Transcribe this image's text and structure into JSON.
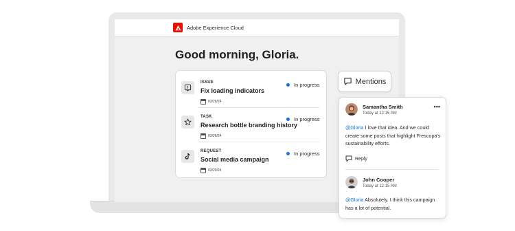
{
  "app": {
    "brand_name": "Adobe Experience Cloud",
    "brand_color": "#eb1000"
  },
  "greeting": "Good morning, Gloria.",
  "work_items": [
    {
      "type": "ISSUE",
      "title": "Fix loading indicators",
      "date": "03/26/24",
      "status": "In progress",
      "icon": "issue-icon"
    },
    {
      "type": "TASK",
      "title": "Research bottle branding history",
      "date": "03/26/24",
      "status": "In progress",
      "icon": "star-icon"
    },
    {
      "type": "REQUEST",
      "title": "Social media campaign",
      "date": "03/29/24",
      "status": "In progress",
      "icon": "tiktok-icon"
    }
  ],
  "status_color": "#1473e6",
  "mentions_button": {
    "label": "Mentions",
    "icon": "comment-icon"
  },
  "comments": [
    {
      "author": "Samantha Smith",
      "time": "Today at 12:15 AM",
      "mention": "@Gloria",
      "text": " I love that idea. And we could create some posts that highlight Frescopa's sustainability efforts.",
      "reply_label": "Reply",
      "more_icon": "more-icon"
    },
    {
      "author": "John Cooper",
      "time": "Today at 12:15 AM",
      "mention": "@Gloria",
      "text": " Absolutely. I think this campaign has a lot of potential."
    }
  ]
}
